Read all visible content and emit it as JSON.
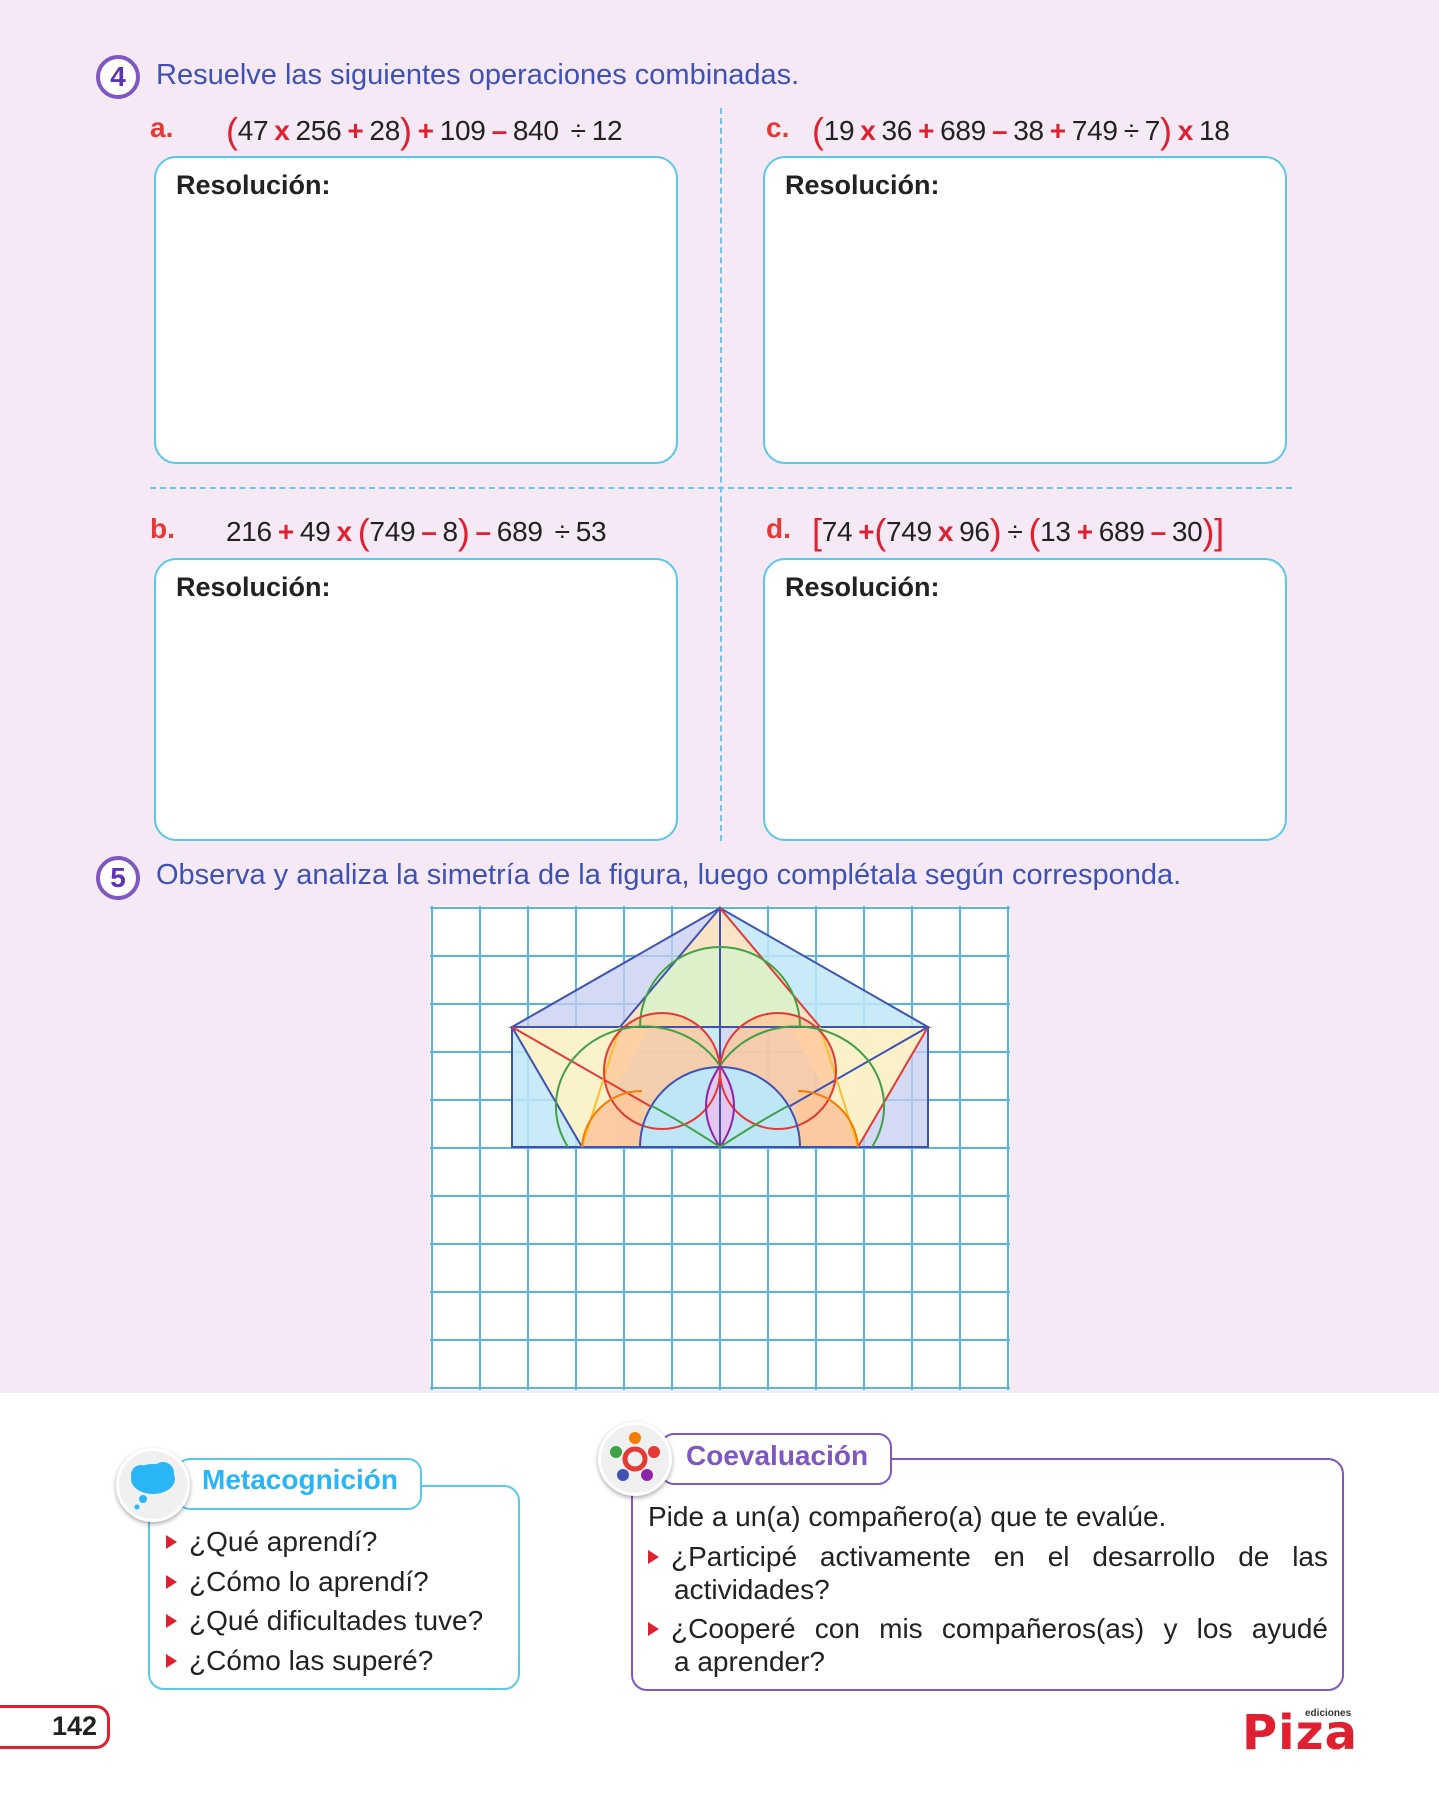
{
  "exercise4": {
    "number": "4",
    "instruction": "Resuelve las siguientes operaciones combinadas.",
    "resolution_label": "Resolución:",
    "items": {
      "a": {
        "letter": "a.",
        "t": [
          "(",
          "47",
          "x",
          "256",
          "+",
          "28",
          ")",
          "+",
          "109",
          "–",
          "840",
          "÷",
          "12"
        ]
      },
      "c": {
        "letter": "c.",
        "t": [
          "(",
          "19",
          "x",
          "36",
          "+",
          "689",
          "–",
          "38",
          "+",
          "749",
          "÷",
          "7",
          ")",
          "x",
          "18"
        ]
      },
      "b": {
        "letter": "b.",
        "t": [
          "216",
          "+",
          "49",
          "x",
          "(",
          "749",
          "–",
          "8",
          ")",
          "–",
          "689",
          "÷",
          "53"
        ]
      },
      "d": {
        "letter": "d.",
        "t": [
          "[",
          "74",
          "+",
          "(",
          "749",
          "x",
          "96",
          ")",
          "÷",
          "(",
          "13",
          "+",
          "689",
          "–",
          "30",
          ")",
          "]"
        ]
      }
    }
  },
  "exercise5": {
    "number": "5",
    "instruction": "Observa y analiza la simetría de la figura, luego complétala según corresponda.",
    "grid": {
      "cols": 12,
      "rows": 10
    },
    "colors": {
      "grid": "#5ab4e6",
      "blue": "#3f51b5",
      "red": "#e53935",
      "orange": "#f57c00",
      "green": "#43a047",
      "yellow": "#fbc02d",
      "purple": "#8e24aa"
    }
  },
  "metacognition": {
    "title": "Metacognición",
    "icon": "thought-cloud-icon",
    "questions": [
      "¿Qué aprendí?",
      "¿Cómo lo aprendí?",
      "¿Qué dificultades tuve?",
      "¿Cómo las superé?"
    ]
  },
  "coevaluation": {
    "title": "Coevaluación",
    "icon": "people-circle-icon",
    "intro": "Pide a un(a) compañero(a) que te evalúe.",
    "questions": [
      {
        "line1": "¿Participé activamente en el desarrollo de las",
        "line2": "actividades?"
      },
      {
        "line1": "¿Cooperé con mis compañeros(as) y los ayudé",
        "line2": "a aprender?"
      }
    ]
  },
  "footer": {
    "page_number": "142",
    "logo": "Piza",
    "logo_small": "ediciones"
  }
}
